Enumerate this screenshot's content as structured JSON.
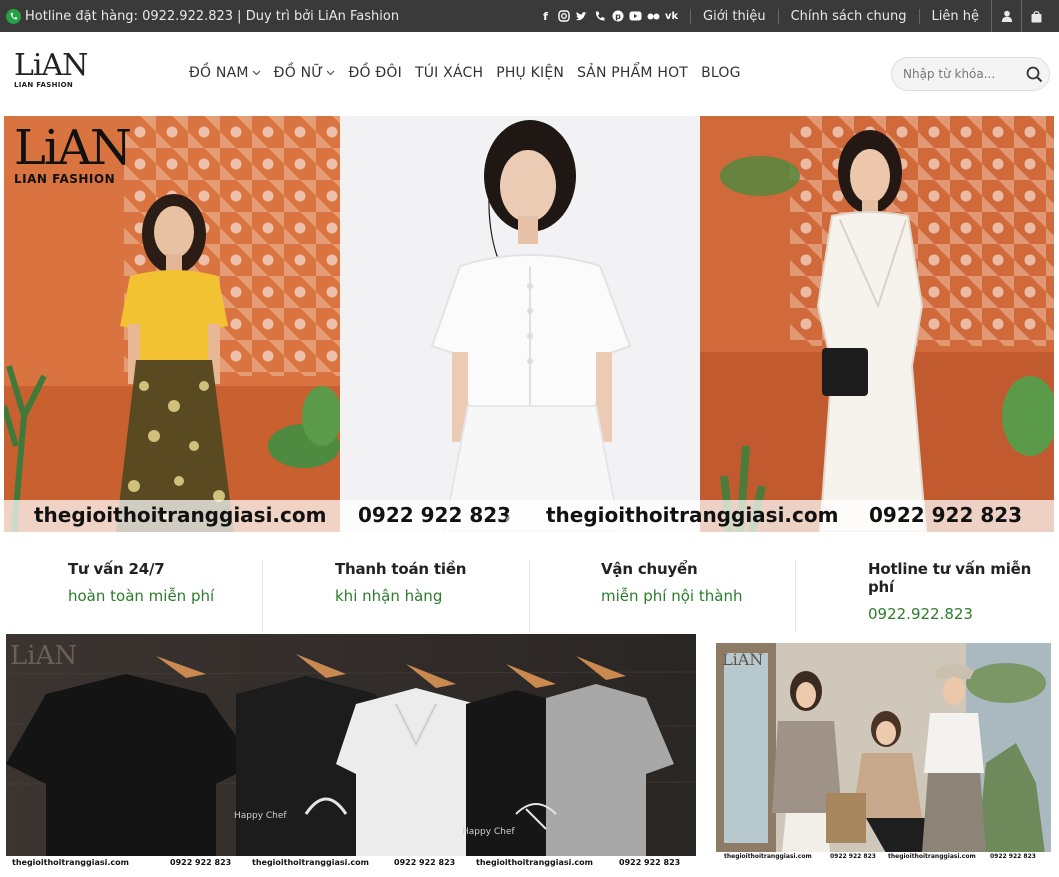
{
  "topbar": {
    "hotline_text": "Hotline đặt hàng: 0922.922.823 | Duy trì bởi LiAn Fashion",
    "social_icons": [
      "facebook-icon",
      "instagram-icon",
      "twitter-icon",
      "phone-icon",
      "pinterest-icon",
      "youtube-icon",
      "flickr-icon",
      "vk-icon"
    ],
    "links": [
      "Giới thiệu",
      "Chính sách chung",
      "Liên hệ"
    ]
  },
  "header": {
    "logo_mark": "LiAN",
    "logo_sub": "LIAN FASHION",
    "nav": [
      {
        "label": "ĐỒ NAM",
        "has_dropdown": true
      },
      {
        "label": "ĐỒ NỮ",
        "has_dropdown": true
      },
      {
        "label": "ĐỒ ĐÔI",
        "has_dropdown": false
      },
      {
        "label": "TÚI XÁCH",
        "has_dropdown": false
      },
      {
        "label": "PHỤ KIỆN",
        "has_dropdown": false
      },
      {
        "label": "SẢN PHẨM HOT",
        "has_dropdown": false
      },
      {
        "label": "BLOG",
        "has_dropdown": false
      }
    ],
    "search_placeholder": "Nhập từ khóa..."
  },
  "hero": {
    "logo_mark": "LiAN",
    "logo_sub": "LIAN FASHION",
    "strip": [
      "thegioithoitranggiasi.com",
      "0922 922 823",
      "thegioithoitranggiasi.com",
      "0922 922 823"
    ]
  },
  "features": [
    {
      "title": "Tư vấn 24/7",
      "desc": "hoàn toàn miễn phí"
    },
    {
      "title": "Thanh toán tiền",
      "desc": "khi nhận hàng"
    },
    {
      "title": "Vận chuyển",
      "desc": "miễn phí nội thành"
    },
    {
      "title": "Hotline tư vấn miễn phí",
      "desc": "0922.922.823"
    }
  ],
  "banner1": {
    "strip": [
      "thegioithoitranggiasi.com",
      "0922 922 823",
      "thegioithoitranggiasi.com",
      "0922 922 823",
      "thegioithoitranggiasi.com",
      "0922 922 823"
    ],
    "tee_print": "Happy Chef"
  },
  "banner2": {
    "strip": [
      "thegioithoitranggiasi.com",
      "0922 922 823",
      "thegioithoitranggiasi.com",
      "0922 922 823"
    ]
  },
  "colors": {
    "topbar": "#3a3a3a",
    "accent_green": "#2b7d2b",
    "hero_orange": "#d9733f"
  }
}
